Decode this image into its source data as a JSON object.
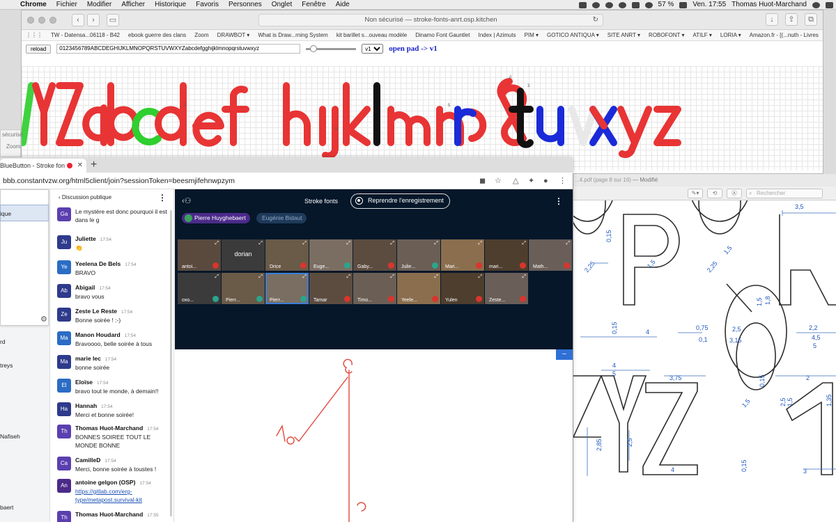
{
  "menubar": {
    "app": "Chrome",
    "items": [
      "Fichier",
      "Modifier",
      "Afficher",
      "Historique",
      "Favoris",
      "Personnes",
      "Onglet",
      "Fenêtre",
      "Aide"
    ],
    "battery": "57 %",
    "clock": "Ven. 17:55",
    "user": "Thomas Huot-Marchand"
  },
  "window_font": {
    "address": "Non sécurisé — stroke-fonts-anrt.osp.kitchen",
    "bookmarks": [
      "TW - Datensa...06118 - B42",
      "ebook guerre des clans",
      "Zoom",
      "DRAWBOT ▾",
      "What is Draw...rning System",
      "kit barillet s...ouveau modèle",
      "Dinamo Font Gauntlet",
      "Index | Azimuts",
      "PIM ▾",
      "GOTICO ANTIQUA ▾",
      "SITE ANRT ▾",
      "ROBOFONT ▾",
      "ATILF ▾",
      "LORIA ▾",
      "Amazon.fr - [(...nuth - Livres"
    ],
    "reload_label": "reload",
    "sample_text": "0123456789ABCDEGHIJKLMNOPQRSTUVWXYZabcdefgghijklmnopqrstuvwxyz",
    "version": "v1",
    "open_pad": "open pad -> v1"
  },
  "ghost_window": {
    "line1": "sécurisé",
    "line2": "Zoom"
  },
  "window_pdf": {
    "title": "...4.pdf (page 8 sur 16)",
    "status": "— Modifié",
    "search_placeholder": "Rechercher",
    "dimensions": [
      "3,5",
      "0,15",
      "2,25",
      "1,5",
      "2,25",
      "1,5",
      "1,5",
      "1,8",
      "0,75",
      "0,1",
      "2,5",
      "3,15",
      "2,2",
      "4,5",
      "5",
      "4",
      "0,15",
      "4",
      "5",
      "3,75",
      "0,15",
      "2,5",
      "1,5",
      "1,5",
      "1,35",
      "2",
      "2,85",
      "2,5",
      "0,15",
      "4",
      "3"
    ]
  },
  "window_bbb": {
    "tab_title": "BlueButton - Stroke fon",
    "url": "bbb.constantvzw.org/html5client/join?sessionToken=beesmjifehnwpzym",
    "users_panel": [
      "ique",
      "rd",
      "treys",
      "Nafiseh",
      "baert"
    ],
    "chat": {
      "header": "Discussion publique",
      "messages": [
        {
          "initials": "Ga",
          "name": "",
          "time": "",
          "text": "Le mystère est donc pourquoi il est dans le g",
          "color": "#5b3fb0"
        },
        {
          "initials": "Ju",
          "name": "Juliette",
          "time": "17:54",
          "text": "👏",
          "color": "#2e3a8c"
        },
        {
          "initials": "Ye",
          "name": "Yeelena De Bels",
          "time": "17:54",
          "text": "BRAVO",
          "color": "#2b6cc4"
        },
        {
          "initials": "Ab",
          "name": "Abigail",
          "time": "17:54",
          "text": "bravo vous",
          "color": "#2e3a8c"
        },
        {
          "initials": "Ze",
          "name": "Zeste Le Reste",
          "time": "17:54",
          "text": "Bonne soirée ! :-)",
          "color": "#2e3a8c"
        },
        {
          "initials": "Ma",
          "name": "Manon Houdard",
          "time": "17:54",
          "text": "Bravoooo, belle soirée à tous",
          "color": "#2b6cc4"
        },
        {
          "initials": "Ma",
          "name": "marie lec",
          "time": "17:54",
          "text": "bonne soirée",
          "color": "#2e3a8c"
        },
        {
          "initials": "El",
          "name": "Eloïse",
          "time": "17:54",
          "text": "bravo tout le monde, à demain!!",
          "color": "#2b6cc4"
        },
        {
          "initials": "Ha",
          "name": "Hannah",
          "time": "17:54",
          "text": "Merci et bonne soirée!",
          "color": "#2e3a8c"
        },
        {
          "initials": "Th",
          "name": "Thomas Huot-Marchand",
          "time": "17:54",
          "text": "BONNES SOIREE TOUT LE MONDE BONNE",
          "color": "#5b3fb0"
        },
        {
          "initials": "Ca",
          "name": "CamilleD",
          "time": "17:54",
          "text": "Merci, bonne soirée à toustes !",
          "color": "#5b3fb0"
        },
        {
          "initials": "An",
          "name": "antoine gelgon (OSP)",
          "time": "17:54",
          "text": "",
          "link": "https://gitlab.com/erg-type/metapost.survival-kit",
          "color": "#4b2a8a"
        },
        {
          "initials": "Th",
          "name": "Thomas Huot-Marchand",
          "time": "17:55",
          "text": "",
          "color": "#5b3fb0"
        }
      ]
    },
    "session_title": "Stroke fonts",
    "record_button": "Reprendre l'enregistrement",
    "speakers": [
      "Pierre Huyghebaert",
      "Eugénie Bidaut"
    ],
    "videos_row1": [
      "antoi...",
      "dorian",
      "Drice",
      "Euge...",
      "Gaby...",
      "Julie...",
      "Mari...",
      "mari...",
      "Math..."
    ],
    "videos_row2": [
      "oxo...",
      "Pierr...",
      "Pierr...",
      "Tamar",
      "Timo...",
      "Yeele...",
      "Yulen",
      "Zeste..."
    ]
  }
}
